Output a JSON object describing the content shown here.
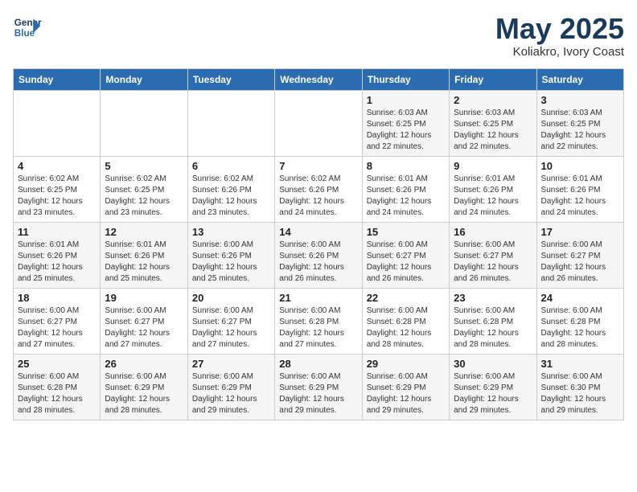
{
  "header": {
    "logo_line1": "General",
    "logo_line2": "Blue",
    "title": "May 2025",
    "location": "Koliakro, Ivory Coast"
  },
  "weekdays": [
    "Sunday",
    "Monday",
    "Tuesday",
    "Wednesday",
    "Thursday",
    "Friday",
    "Saturday"
  ],
  "weeks": [
    [
      {
        "day": "",
        "info": ""
      },
      {
        "day": "",
        "info": ""
      },
      {
        "day": "",
        "info": ""
      },
      {
        "day": "",
        "info": ""
      },
      {
        "day": "1",
        "info": "Sunrise: 6:03 AM\nSunset: 6:25 PM\nDaylight: 12 hours\nand 22 minutes."
      },
      {
        "day": "2",
        "info": "Sunrise: 6:03 AM\nSunset: 6:25 PM\nDaylight: 12 hours\nand 22 minutes."
      },
      {
        "day": "3",
        "info": "Sunrise: 6:03 AM\nSunset: 6:25 PM\nDaylight: 12 hours\nand 22 minutes."
      }
    ],
    [
      {
        "day": "4",
        "info": "Sunrise: 6:02 AM\nSunset: 6:25 PM\nDaylight: 12 hours\nand 23 minutes."
      },
      {
        "day": "5",
        "info": "Sunrise: 6:02 AM\nSunset: 6:25 PM\nDaylight: 12 hours\nand 23 minutes."
      },
      {
        "day": "6",
        "info": "Sunrise: 6:02 AM\nSunset: 6:26 PM\nDaylight: 12 hours\nand 23 minutes."
      },
      {
        "day": "7",
        "info": "Sunrise: 6:02 AM\nSunset: 6:26 PM\nDaylight: 12 hours\nand 24 minutes."
      },
      {
        "day": "8",
        "info": "Sunrise: 6:01 AM\nSunset: 6:26 PM\nDaylight: 12 hours\nand 24 minutes."
      },
      {
        "day": "9",
        "info": "Sunrise: 6:01 AM\nSunset: 6:26 PM\nDaylight: 12 hours\nand 24 minutes."
      },
      {
        "day": "10",
        "info": "Sunrise: 6:01 AM\nSunset: 6:26 PM\nDaylight: 12 hours\nand 24 minutes."
      }
    ],
    [
      {
        "day": "11",
        "info": "Sunrise: 6:01 AM\nSunset: 6:26 PM\nDaylight: 12 hours\nand 25 minutes."
      },
      {
        "day": "12",
        "info": "Sunrise: 6:01 AM\nSunset: 6:26 PM\nDaylight: 12 hours\nand 25 minutes."
      },
      {
        "day": "13",
        "info": "Sunrise: 6:00 AM\nSunset: 6:26 PM\nDaylight: 12 hours\nand 25 minutes."
      },
      {
        "day": "14",
        "info": "Sunrise: 6:00 AM\nSunset: 6:26 PM\nDaylight: 12 hours\nand 26 minutes."
      },
      {
        "day": "15",
        "info": "Sunrise: 6:00 AM\nSunset: 6:27 PM\nDaylight: 12 hours\nand 26 minutes."
      },
      {
        "day": "16",
        "info": "Sunrise: 6:00 AM\nSunset: 6:27 PM\nDaylight: 12 hours\nand 26 minutes."
      },
      {
        "day": "17",
        "info": "Sunrise: 6:00 AM\nSunset: 6:27 PM\nDaylight: 12 hours\nand 26 minutes."
      }
    ],
    [
      {
        "day": "18",
        "info": "Sunrise: 6:00 AM\nSunset: 6:27 PM\nDaylight: 12 hours\nand 27 minutes."
      },
      {
        "day": "19",
        "info": "Sunrise: 6:00 AM\nSunset: 6:27 PM\nDaylight: 12 hours\nand 27 minutes."
      },
      {
        "day": "20",
        "info": "Sunrise: 6:00 AM\nSunset: 6:27 PM\nDaylight: 12 hours\nand 27 minutes."
      },
      {
        "day": "21",
        "info": "Sunrise: 6:00 AM\nSunset: 6:28 PM\nDaylight: 12 hours\nand 27 minutes."
      },
      {
        "day": "22",
        "info": "Sunrise: 6:00 AM\nSunset: 6:28 PM\nDaylight: 12 hours\nand 28 minutes."
      },
      {
        "day": "23",
        "info": "Sunrise: 6:00 AM\nSunset: 6:28 PM\nDaylight: 12 hours\nand 28 minutes."
      },
      {
        "day": "24",
        "info": "Sunrise: 6:00 AM\nSunset: 6:28 PM\nDaylight: 12 hours\nand 28 minutes."
      }
    ],
    [
      {
        "day": "25",
        "info": "Sunrise: 6:00 AM\nSunset: 6:28 PM\nDaylight: 12 hours\nand 28 minutes."
      },
      {
        "day": "26",
        "info": "Sunrise: 6:00 AM\nSunset: 6:29 PM\nDaylight: 12 hours\nand 28 minutes."
      },
      {
        "day": "27",
        "info": "Sunrise: 6:00 AM\nSunset: 6:29 PM\nDaylight: 12 hours\nand 29 minutes."
      },
      {
        "day": "28",
        "info": "Sunrise: 6:00 AM\nSunset: 6:29 PM\nDaylight: 12 hours\nand 29 minutes."
      },
      {
        "day": "29",
        "info": "Sunrise: 6:00 AM\nSunset: 6:29 PM\nDaylight: 12 hours\nand 29 minutes."
      },
      {
        "day": "30",
        "info": "Sunrise: 6:00 AM\nSunset: 6:29 PM\nDaylight: 12 hours\nand 29 minutes."
      },
      {
        "day": "31",
        "info": "Sunrise: 6:00 AM\nSunset: 6:30 PM\nDaylight: 12 hours\nand 29 minutes."
      }
    ]
  ]
}
